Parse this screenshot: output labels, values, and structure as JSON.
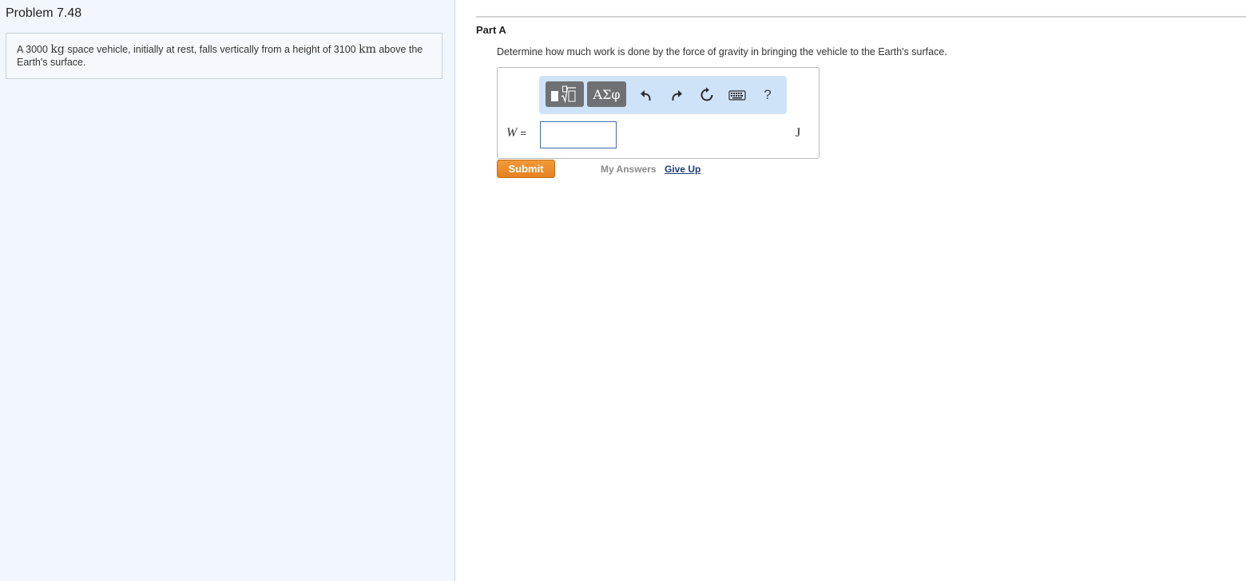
{
  "problem": {
    "title": "Problem 7.48",
    "text_parts": [
      "A 3000 ",
      "kg",
      " space vehicle, initially at rest, falls vertically from a height of 3100 ",
      "km",
      " above the Earth's surface."
    ]
  },
  "part": {
    "label": "Part A",
    "question": "Determine how much work is done by the force of gravity in bringing the vehicle to the Earth's surface."
  },
  "toolbar": {
    "templates_icon": "templates-icon",
    "greek_label": "ΑΣφ",
    "undo_icon": "undo-icon",
    "redo_icon": "redo-icon",
    "reset_icon": "reset-icon",
    "keyboard_icon": "keyboard-icon",
    "help_label": "?"
  },
  "answer": {
    "variable": "W",
    "equals": "=",
    "value": "",
    "unit": "J"
  },
  "actions": {
    "submit_label": "Submit",
    "my_answers_label": "My Answers",
    "give_up_label": "Give Up"
  },
  "colors": {
    "left_panel_bg": "#f2f7fd",
    "toolbar_bg": "#cfe3f8",
    "submit_bg": "#e98a25",
    "link": "#1d3f7a"
  }
}
